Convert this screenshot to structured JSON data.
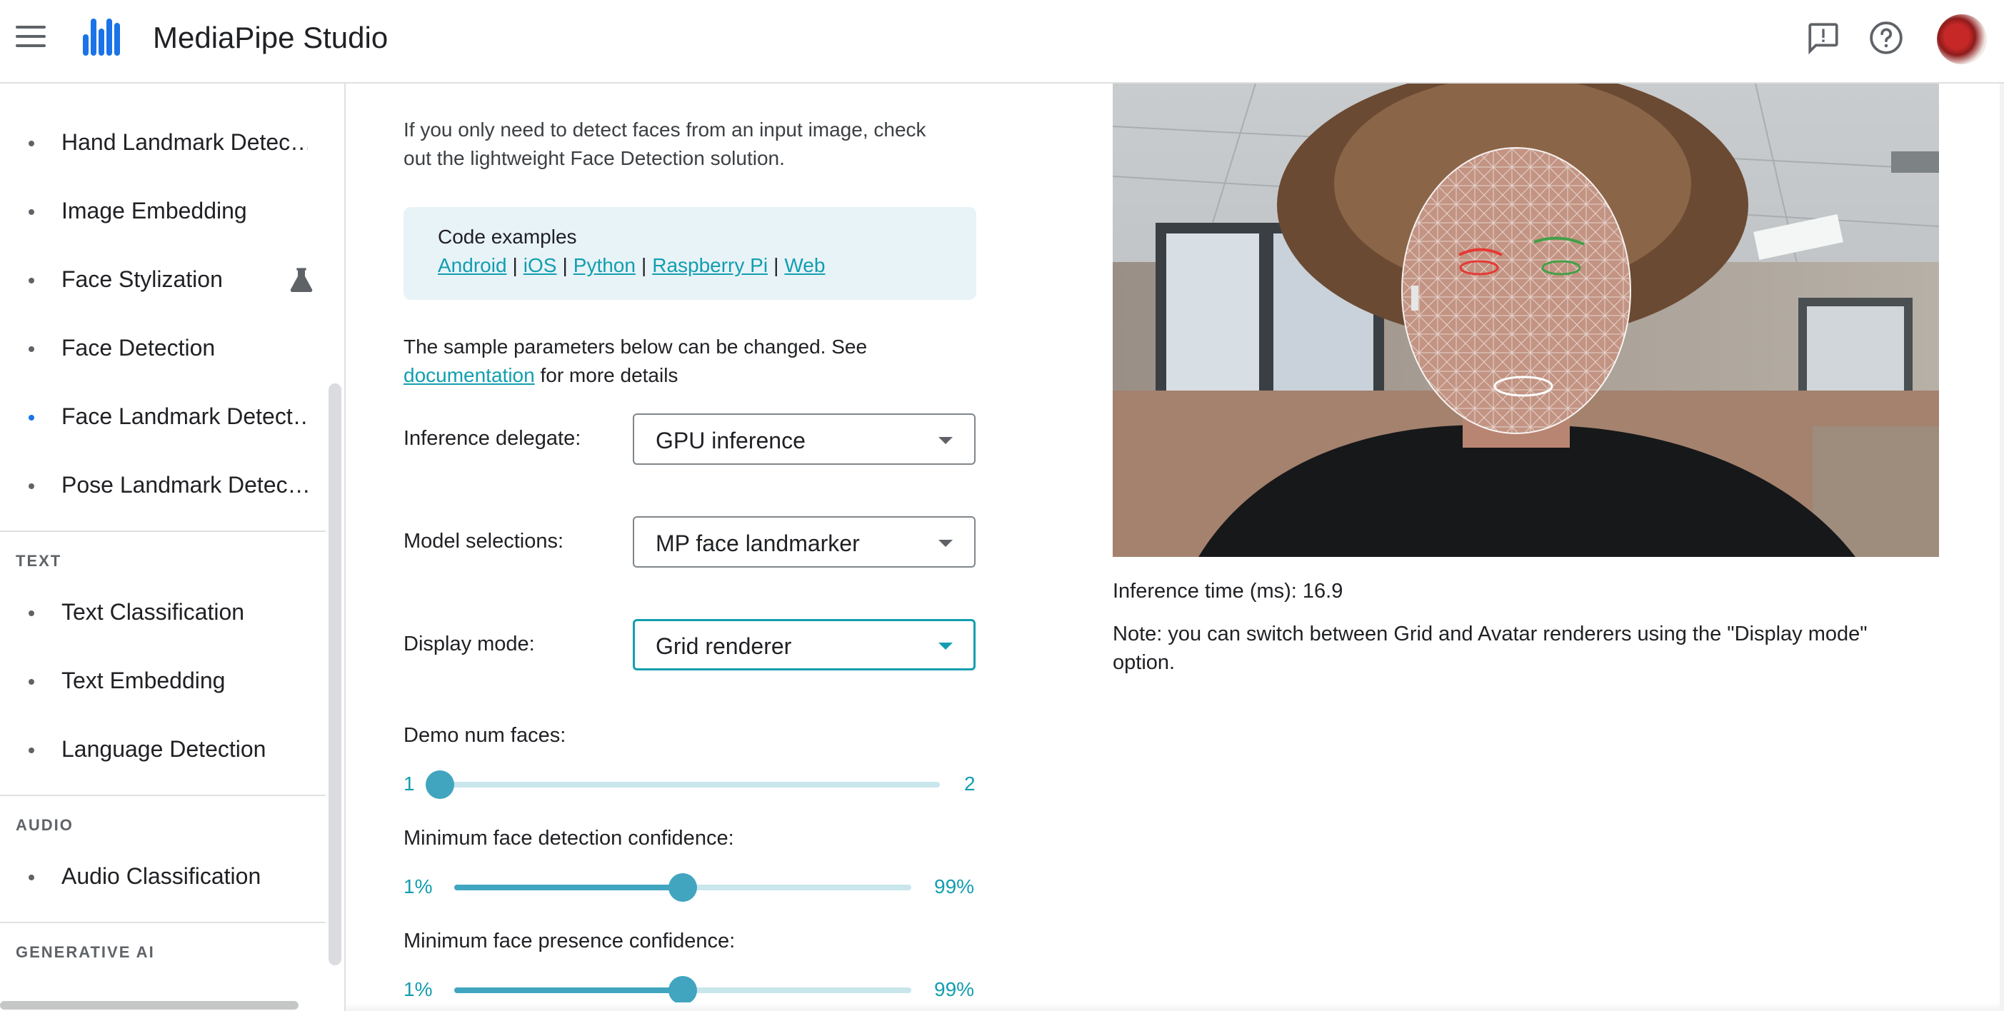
{
  "header": {
    "title": "MediaPipe Studio",
    "icons": [
      "menu-icon",
      "mediapipe-logo",
      "feedback-icon",
      "help-icon",
      "avatar"
    ]
  },
  "sidebar": {
    "items": [
      {
        "label": "Hand Landmark Detec…"
      },
      {
        "label": "Image Embedding"
      },
      {
        "label": "Face Stylization",
        "icon": "flask-icon"
      },
      {
        "label": "Face Detection"
      },
      {
        "label": "Face Landmark Detect…",
        "active": true
      },
      {
        "label": "Pose Landmark Detec…"
      }
    ],
    "sections": {
      "text": "TEXT",
      "audio": "AUDIO",
      "generative": "GENERATIVE AI"
    },
    "text_items": [
      {
        "label": "Text Classification"
      },
      {
        "label": "Text Embedding"
      },
      {
        "label": "Language Detection"
      }
    ],
    "audio_items": [
      {
        "label": "Audio Classification"
      }
    ]
  },
  "main": {
    "intro_line1": "If you only need to detect faces from an input image, check",
    "intro_line2": "out the lightweight Face Detection solution.",
    "code_examples": {
      "title": "Code examples",
      "links": [
        "Android",
        "iOS",
        "Python",
        "Raspberry Pi",
        "Web"
      ],
      "separator": "|"
    },
    "params_line1": "The sample parameters below can be changed. See",
    "params_link": "documentation",
    "params_rest": " for more details",
    "fields": {
      "inference_delegate": {
        "label": "Inference delegate:",
        "value": "GPU inference"
      },
      "model_selections": {
        "label": "Model selections:",
        "value": "MP face landmarker"
      },
      "display_mode": {
        "label": "Display mode:",
        "value": "Grid renderer"
      }
    },
    "sliders": {
      "num_faces": {
        "label": "Demo num faces:",
        "min": "1",
        "max": "2",
        "value": 1
      },
      "detection_confidence": {
        "label": "Minimum face detection confidence:",
        "min": "1%",
        "max": "99%",
        "value": 0.5
      },
      "presence_confidence": {
        "label": "Minimum face presence confidence:",
        "min": "1%",
        "max": "99%",
        "value": 0.5
      }
    }
  },
  "preview": {
    "inference_time": "Inference time (ms): 16.9",
    "note_line1": "Note: you can switch between Grid and Avatar renderers using the \"Display mode\"",
    "note_line2": "option."
  }
}
